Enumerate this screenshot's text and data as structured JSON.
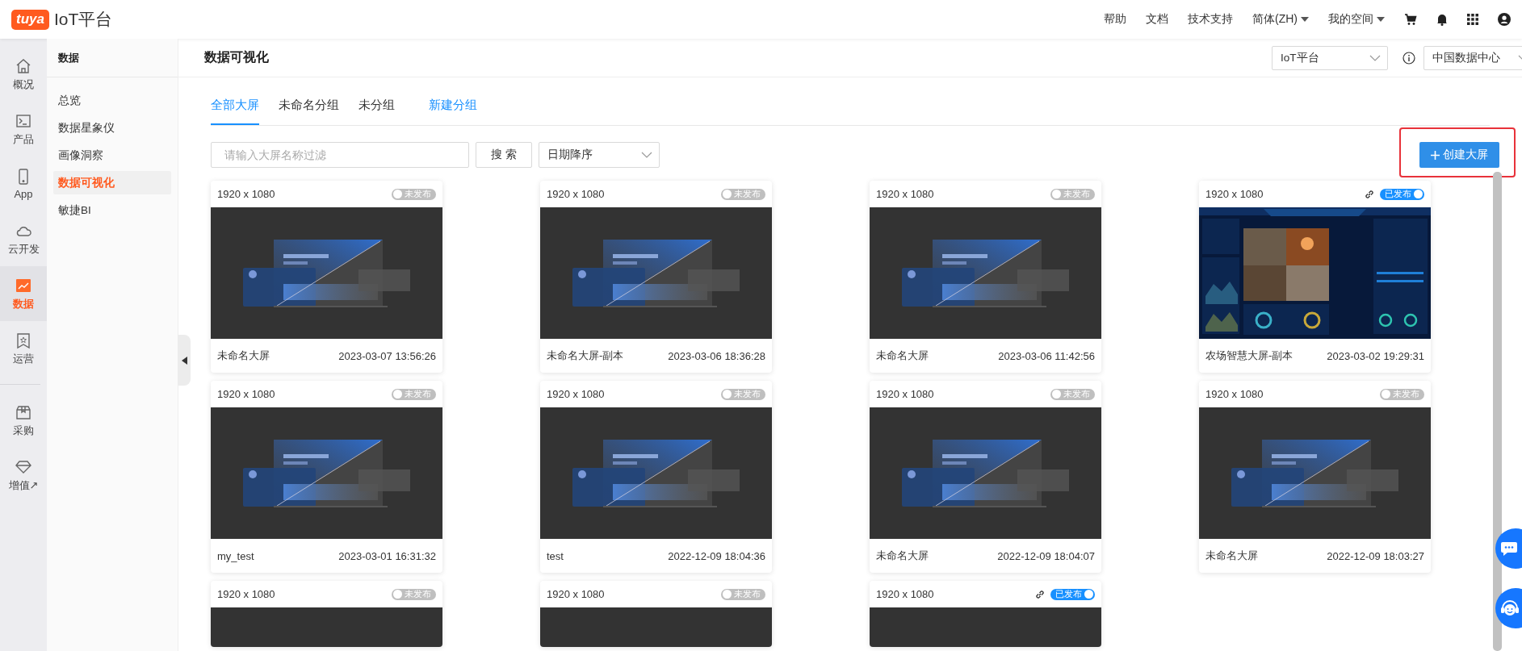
{
  "topbar": {
    "logo_badge": "tuya",
    "logo_text": "IoT平台",
    "links": [
      {
        "label": "帮助",
        "dropdown": false
      },
      {
        "label": "文档",
        "dropdown": false
      },
      {
        "label": "技术支持",
        "dropdown": false
      },
      {
        "label": "简体(ZH)",
        "dropdown": true
      },
      {
        "label": "我的空间",
        "dropdown": true
      }
    ]
  },
  "rail": {
    "groups": [
      [
        {
          "label": "概况",
          "selected": false
        },
        {
          "label": "产品",
          "selected": false
        },
        {
          "label": "App",
          "selected": false
        },
        {
          "label": "云开发",
          "selected": false
        },
        {
          "label": "数据",
          "selected": true
        },
        {
          "label": "运营",
          "selected": false
        }
      ],
      [
        {
          "label": "采购",
          "selected": false
        },
        {
          "label": "增值↗",
          "selected": false
        }
      ]
    ]
  },
  "subnav": {
    "title": "数据",
    "items": [
      {
        "label": "总览",
        "selected": false
      },
      {
        "label": "数据星象仪",
        "selected": false
      },
      {
        "label": "画像洞察",
        "selected": false
      },
      {
        "label": "数据可视化",
        "selected": true
      },
      {
        "label": "敏捷BI",
        "selected": false
      }
    ]
  },
  "header": {
    "title": "数据可视化",
    "platform_select": "IoT平台",
    "region_select": "中国数据中心"
  },
  "tabs": [
    {
      "label": "全部大屏",
      "selected": true
    },
    {
      "label": "未命名分组",
      "selected": false
    },
    {
      "label": "未分组",
      "selected": false
    }
  ],
  "new_group_link": "新建分组",
  "filter": {
    "search": {
      "placeholder": "请输入大屏名称过滤"
    },
    "search_button": "搜 索",
    "sort_select": "日期降序"
  },
  "create_button": {
    "label": "创建大屏",
    "highlighted": true
  },
  "cards": [
    {
      "size": "1920 x 1080",
      "status": "未发布",
      "published": false,
      "kind": "template",
      "name": "未命名大屏",
      "date": "2023-03-07 13:56:26"
    },
    {
      "size": "1920 x 1080",
      "status": "未发布",
      "published": false,
      "kind": "template",
      "name": "未命名大屏-副本",
      "date": "2023-03-06 18:36:28"
    },
    {
      "size": "1920 x 1080",
      "status": "未发布",
      "published": false,
      "kind": "template",
      "name": "未命名大屏",
      "date": "2023-03-06 11:42:56"
    },
    {
      "size": "1920 x 1080",
      "status": "已发布",
      "published": true,
      "kind": "dashboard",
      "name": "农场智慧大屏-副本",
      "date": "2023-03-02 19:29:31"
    },
    {
      "size": "1920 x 1080",
      "status": "未发布",
      "published": false,
      "kind": "template",
      "name": "my_test",
      "date": "2023-03-01 16:31:32"
    },
    {
      "size": "1920 x 1080",
      "status": "未发布",
      "published": false,
      "kind": "template",
      "name": "test",
      "date": "2022-12-09 18:04:36"
    },
    {
      "size": "1920 x 1080",
      "status": "未发布",
      "published": false,
      "kind": "template",
      "name": "未命名大屏",
      "date": "2022-12-09 18:04:07"
    },
    {
      "size": "1920 x 1080",
      "status": "未发布",
      "published": false,
      "kind": "template",
      "name": "未命名大屏",
      "date": "2022-12-09 18:03:27"
    },
    {
      "size": "1920 x 1080",
      "status": "未发布",
      "published": false
    },
    {
      "size": "1920 x 1080",
      "status": "未发布",
      "published": false
    },
    {
      "size": "1920 x 1080",
      "status": "已发布",
      "published": true
    }
  ]
}
